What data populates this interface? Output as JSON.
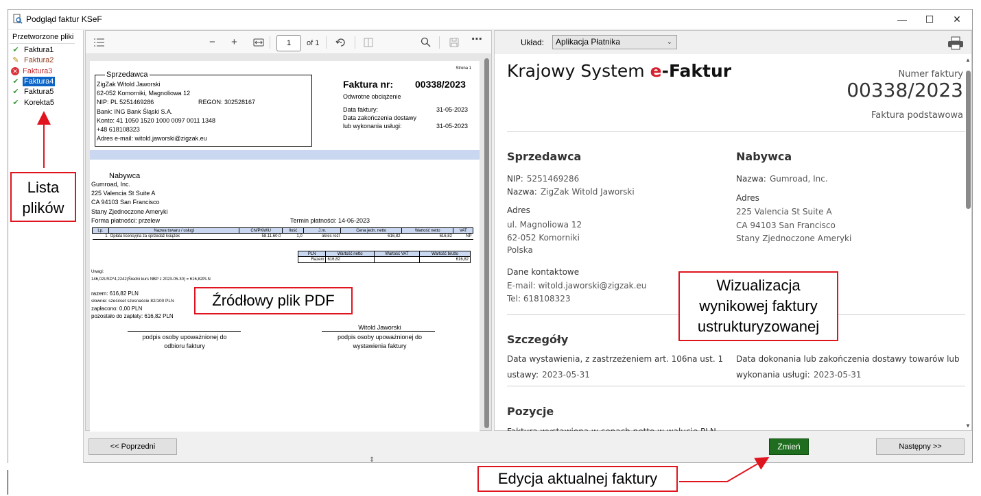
{
  "window": {
    "title": "Podgląd faktur KSeF",
    "minimize": "—",
    "maximize": "☐",
    "close": "✕"
  },
  "file_list": {
    "header": "Przetworzone pliki",
    "items": [
      {
        "label": "Faktura1",
        "status": "ok",
        "color": "#000000"
      },
      {
        "label": "Faktura2",
        "status": "edit",
        "color": "#8b3a1c"
      },
      {
        "label": "Faktura3",
        "status": "error",
        "color": "#c0282d"
      },
      {
        "label": "Faktura4",
        "status": "ok",
        "color": "#ffffff",
        "selected": true
      },
      {
        "label": "Faktura5",
        "status": "ok",
        "color": "#000000"
      },
      {
        "label": "Korekta5",
        "status": "ok",
        "color": "#000000"
      }
    ]
  },
  "pdf_viewer": {
    "page": "1",
    "of_pages": "of 1",
    "document": {
      "strona": "Strona 1",
      "seller_heading": "Sprzedawca",
      "seller_lines": [
        "ZigZak Witold Jaworski",
        "62-052 Komorniki, Magnoliowa 12",
        "NIP: PL 5251469286",
        "Bank: ING Bank Śląski S.A.",
        "Konto: 41 1050 1520 1000 0097 0011 1348",
        "+48 618108323",
        "Adres e-mail: witold.jaworski@zigzak.eu"
      ],
      "regon": "REGON: 302528167",
      "invoice_label": "Faktura nr:",
      "invoice_number": "00338/2023",
      "reverse_charge": "Odwrotne obciążenie",
      "date_invoice_label": "Data faktury:",
      "date_invoice": "31-05-2023",
      "date_delivery_label1": "Data zakończenia dostawy",
      "date_delivery_label2": "lub wykonania usługi:",
      "date_delivery": "31-05-2023",
      "buyer_heading": "Nabywca",
      "buyer_lines": [
        "Gumroad, Inc.",
        "225 Valencia St Suite A",
        "CA 94103 San Francisco",
        "Stany Zjednoczone Ameryki"
      ],
      "payment_form": "Forma płatności: przelew",
      "payment_due": "Termin płatności: 14-06-2023",
      "items_table": {
        "headers": [
          "Lp.",
          "Nazwa towaru / usługi",
          "CN/PKWiU",
          "Ilość",
          "J.m.",
          "Cena jedn. netto",
          "Wartość netto",
          "VAT"
        ],
        "rows": [
          [
            "1",
            "Opłata licencyjna za sprzedaż książek",
            "58.11.60.0",
            "1,0",
            "okres rozl",
            "616,82",
            "616,82",
            "NP"
          ]
        ]
      },
      "summary_table": {
        "headers": [
          "PLN",
          "Wartość netto",
          "Wartość VAT",
          "Wartość brutto"
        ],
        "rows": [
          [
            "Razem",
            "616,82",
            "",
            "616,82"
          ]
        ]
      },
      "notes_label": "Uwagi:",
      "notes_text": "146,02USD*4,2242(Średni kurs NBP z 2023-05-30) = 616,82PLN",
      "total": "razem: 616,82 PLN",
      "in_words": "słownie: sześćset szesnaście 82/100 PLN",
      "paid": "zapłacono: 0,00 PLN",
      "remaining": "pozostało do zapłaty: 616,82 PLN",
      "sign_left_1": "podpis osoby upoważnionej do",
      "sign_left_2": "odbioru faktury",
      "sign_right_name": "Witold Jaworski",
      "sign_right_1": "podpis osoby upoważnionej do",
      "sign_right_2": "wystawienia faktury"
    }
  },
  "ksef_view": {
    "layout_label": "Układ:",
    "layout_value": "Aplikacja Płatnika",
    "brand_prefix": "Krajowy System ",
    "brand_e": "e",
    "brand_suffix": "-Faktur",
    "number_label": "Numer faktury",
    "number": "00338/2023",
    "invoice_type": "Faktura podstawowa",
    "seller": {
      "heading": "Sprzedawca",
      "nip_label": "NIP:",
      "nip": "5251469286",
      "name_label": "Nazwa:",
      "name": "ZigZak Witold Jaworski",
      "address_label": "Adres",
      "address_lines": [
        "ul. Magnoliowa 12",
        "62-052 Komorniki",
        "Polska"
      ],
      "contact_label": "Dane kontaktowe",
      "email": "E-mail: witold.jaworski@zigzak.eu",
      "tel": "Tel: 618108323"
    },
    "buyer": {
      "heading": "Nabywca",
      "name_label": "Nazwa:",
      "name": "Gumroad, Inc.",
      "address_label": "Adres",
      "address_lines": [
        "225 Valencia St Suite A",
        "CA 94103 San Francisco",
        "Stany Zjednoczone Ameryki"
      ]
    },
    "details": {
      "heading": "Szczegóły",
      "issue_line1": "Data wystawienia, z zastrzeżeniem art. 106na ust. 1",
      "issue_line2_label": "ustawy:",
      "issue_date": "2023-05-31",
      "delivery_line1": "Data dokonania lub zakończenia dostawy towarów lub",
      "delivery_line2_label": "wykonania usługi:",
      "delivery_date": "2023-05-31"
    },
    "positions": {
      "heading": "Pozycje",
      "currency_note": "Faktura wystawiona w cenach netto w walucie PLN"
    }
  },
  "footer": {
    "prev": "<< Poprzedni",
    "change": "Zmień",
    "next": "Następny >>"
  },
  "annotations": {
    "file_list": [
      "Lista",
      "plików"
    ],
    "source_pdf": "Źródłowy plik PDF",
    "visualization": [
      "Wizualizacja",
      "wynikowej faktury",
      "ustrukturyzowanej"
    ],
    "edit": "Edycja aktualnej faktury"
  },
  "colors": {
    "accent_red": "#e0141e",
    "brand_red": "#d5202e",
    "green_button": "#1f6d1f",
    "selection_blue": "#0b63c5",
    "table_header_blue": "#c9d7f0"
  }
}
